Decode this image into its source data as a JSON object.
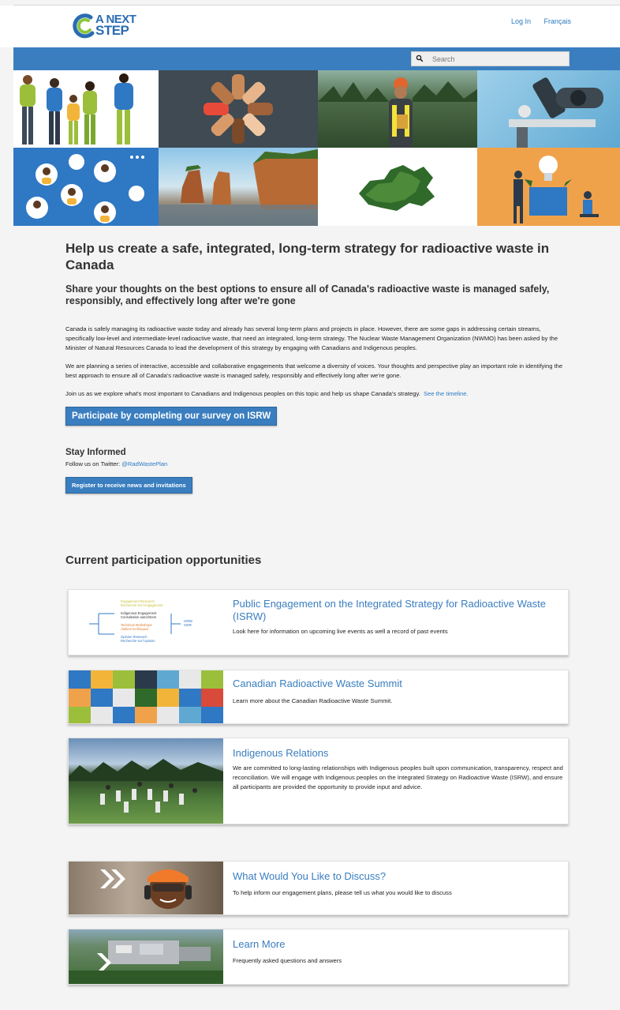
{
  "header": {
    "logo_line1": "A NEXT",
    "logo_line2": "STEP",
    "login": "Log In",
    "language": "Français",
    "search_placeholder": "Search"
  },
  "main": {
    "title": "Help us create a safe, integrated, long-term strategy for radioactive waste in Canada",
    "subtitle": "Share your thoughts on the best options to ensure all of Canada's radioactive waste is managed safely, responsibly, and effectively long after we're gone",
    "para1": "Canada is safely managing its radioactive waste today and already has several long-term plans and projects in place. However, there are some gaps in addressing certain streams, specifically low-level and intermediate-level radioactive waste, that need an integrated, long-term strategy. The Nuclear Waste Management Organization (NWMO) has been asked by the Minister of Natural Resources Canada to lead the development of this strategy by engaging with Canadians and Indigenous peoples.",
    "para2": "We are planning a series of interactive, accessible and collaborative engagements that welcome a diversity of voices. Your thoughts and perspective play an important role in identifying the best approach to ensure all of Canada's radioactive waste is managed safely, responsibly and effectively long after we're gone.",
    "para3": "Join us as we explore what's most important to Canadians and Indigenous peoples on this topic and help us shape Canada's strategy.",
    "timeline_link": "See the timeline.",
    "survey_button": "Participate by completing our survey on ISRW",
    "stay_informed": "Stay Informed",
    "follow_text": "Follow us on Twitter:",
    "twitter_handle": "@RadWastePlan",
    "register_button": "Register to receive news and invitations"
  },
  "opportunities": {
    "heading": "Current participation opportunities",
    "cards": [
      {
        "title": "Public Engagement on the Integrated Strategy for Radioactive Waste (ISRW)",
        "desc": "Look here for information on upcoming live events as well a record of past events"
      },
      {
        "title": "Canadian Radioactive Waste Summit",
        "desc": "Learn more about the Canadian Radioactive Waste Summit."
      },
      {
        "title": "Indigenous Relations",
        "desc": "We are committed to long-lasting relationships with Indigenous peoples built upon communication, transparency, respect and reconciliation. We will engage with Indigenous peoples on the Integrated Strategy on Radioactive Waste (ISRW), and ensure all participants are provided the opportunity to provide input and advice."
      },
      {
        "title": "What Would You Like to Discuss?",
        "desc": "To help inform our engagement plans, please tell us what you would like to discuss"
      },
      {
        "title": "Learn More",
        "desc": "Frequently asked questions and answers"
      }
    ]
  },
  "diagram_thumb": {
    "line1": "Engagement Research",
    "line2": "Recherche sur l'engagement",
    "line3": "Indigenous Engagement",
    "line4": "Consultation autochtone",
    "line5": "Technical Workshops",
    "line6": "Ateliers techniques",
    "line7": "Opinion Research",
    "line8": "Recherche sur l'opinion",
    "right1": "ISRW",
    "right2": "SIDR"
  },
  "colors": {
    "brand_blue": "#3a7ebf",
    "link_blue": "#2b7bc3",
    "page_bg": "#f4f4f4"
  }
}
